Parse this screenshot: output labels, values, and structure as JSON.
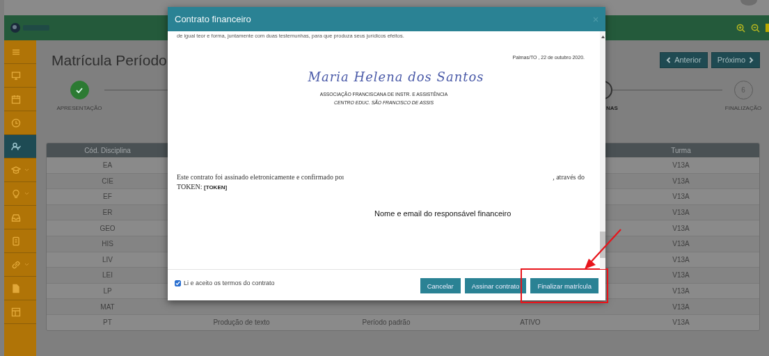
{
  "page_title": "Matrícula Período",
  "nav_buttons": [
    {
      "label": "Anterior",
      "kind": "prev"
    },
    {
      "label": "Próximo",
      "kind": "next"
    }
  ],
  "sidebar": {
    "items": [
      {
        "kind": "menu",
        "selected": false,
        "submenu": false
      },
      {
        "kind": "monitor",
        "selected": false,
        "submenu": false
      },
      {
        "kind": "calendar",
        "selected": false,
        "submenu": false
      },
      {
        "kind": "clock",
        "selected": false,
        "submenu": false
      },
      {
        "kind": "user",
        "selected": true,
        "submenu": false
      },
      {
        "kind": "cap",
        "selected": false,
        "submenu": true
      },
      {
        "kind": "bulb",
        "selected": false,
        "submenu": true
      },
      {
        "kind": "inbox",
        "selected": false,
        "submenu": false
      },
      {
        "kind": "doc",
        "selected": false,
        "submenu": false
      },
      {
        "kind": "link",
        "selected": false,
        "submenu": true
      },
      {
        "kind": "file",
        "selected": false,
        "submenu": false
      },
      {
        "kind": "layout",
        "selected": false,
        "submenu": false
      }
    ]
  },
  "steps": [
    {
      "label": "APRESENTAÇÃO",
      "completed": true,
      "current": false
    },
    {
      "label": "NAS",
      "completed": false,
      "current": true
    },
    {
      "number": "6",
      "label": "FINALIZAÇÃO",
      "completed": false,
      "current": false
    }
  ],
  "table": {
    "columns": [
      "Cód. Disciplina",
      "Turma"
    ],
    "rows": [
      {
        "code": "EA",
        "turma": "V13A"
      },
      {
        "code": "CIE",
        "turma": "V13A"
      },
      {
        "code": "EF",
        "turma": "V13A"
      },
      {
        "code": "ER",
        "turma": "V13A"
      },
      {
        "code": "GEO",
        "turma": "V13A"
      },
      {
        "code": "HIS",
        "turma": "V13A"
      },
      {
        "code": "LIV",
        "turma": "V13A"
      },
      {
        "code": "LEI",
        "turma": "V13A"
      },
      {
        "code": "LP",
        "turma": "V13A"
      },
      {
        "code": "MAT",
        "turma": "V13A"
      },
      {
        "code": "PT",
        "name": "Produção de texto",
        "period": "Período padrão",
        "status": "ATIVO",
        "turma": "V13A"
      }
    ]
  },
  "modal": {
    "title": "Contrato financeiro",
    "cut_line": "de igual teor e forma, juntamente com duas testemunhas, para que produza seus jurídicos efeitos.",
    "place_date": "Palmas/TO , 22 de outubro 2020.",
    "signature": "Maria Helena dos Santos",
    "org_name": "ASSOCIAÇÃO FRANCISCANA DE INSTR. E ASSISTÊNCIA",
    "org_unit": "CENTRO EDUC. SÃO FRANCISCO DE ASSIS",
    "signed_start": "Este contrato foi assinado eletronicamente e confirmado poı",
    "signed_end": ", através do",
    "token_line": "TOKEN: **[TOKEN]**",
    "note": "Nome e email do responsável financeiro",
    "accept": {
      "label": "Li e aceito os termos do contrato",
      "checked": true
    },
    "buttons": [
      {
        "label": "Cancelar",
        "highlighted": false
      },
      {
        "label": "Assinar contrato",
        "highlighted": false
      },
      {
        "label": "Finalizar matrícula",
        "highlighted": true
      }
    ]
  }
}
